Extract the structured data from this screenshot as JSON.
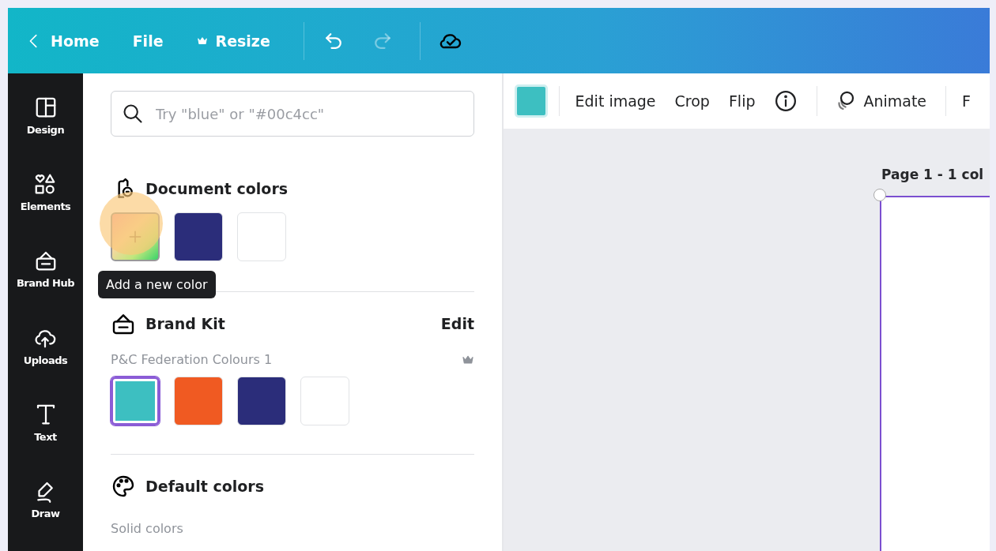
{
  "topbar": {
    "back": {
      "label": "Home"
    },
    "menu": [
      {
        "kind": "text",
        "label": "File"
      },
      {
        "kind": "crown",
        "label": "Resize"
      }
    ],
    "undo_disabled": false,
    "redo_disabled": true
  },
  "sidebar": {
    "items": [
      {
        "kind": "design",
        "label": "Design"
      },
      {
        "kind": "elements",
        "label": "Elements"
      },
      {
        "kind": "brand",
        "label": "Brand Hub"
      },
      {
        "kind": "uploads",
        "label": "Uploads"
      },
      {
        "kind": "text",
        "label": "Text"
      },
      {
        "kind": "draw",
        "label": "Draw"
      }
    ]
  },
  "panel": {
    "search": {
      "placeholder": "Try \"blue\" or \"#00c4cc\""
    },
    "document_colors": {
      "title": "Document colors",
      "tooltip": "Add a new color",
      "swatches": [
        {
          "kind": "add",
          "highlighted": true
        },
        {
          "kind": "color",
          "color": "#2b2d7a"
        },
        {
          "kind": "color",
          "color": "#ffffff"
        }
      ]
    },
    "brand_kit": {
      "title": "Brand Kit",
      "edit": "Edit",
      "palette_name": "P&C Federation Colours 1",
      "swatches": [
        {
          "color": "#3dbfc1",
          "selected": true
        },
        {
          "color": "#f05a22",
          "selected": false
        },
        {
          "color": "#2b2d7a",
          "selected": false
        },
        {
          "color": "#ffffff",
          "selected": false
        }
      ]
    },
    "default_colors": {
      "title": "Default colors",
      "subtitle": "Solid colors"
    }
  },
  "toolbar": {
    "color": "#3dbfc1",
    "items": [
      {
        "kind": "text",
        "label": "Edit image"
      },
      {
        "kind": "text",
        "label": "Crop"
      },
      {
        "kind": "text",
        "label": "Flip"
      },
      {
        "kind": "info"
      },
      {
        "kind": "animate",
        "label": "Animate"
      },
      {
        "kind": "text",
        "label": "F"
      }
    ]
  },
  "canvas": {
    "page_label": "Page 1 - 1 col"
  }
}
